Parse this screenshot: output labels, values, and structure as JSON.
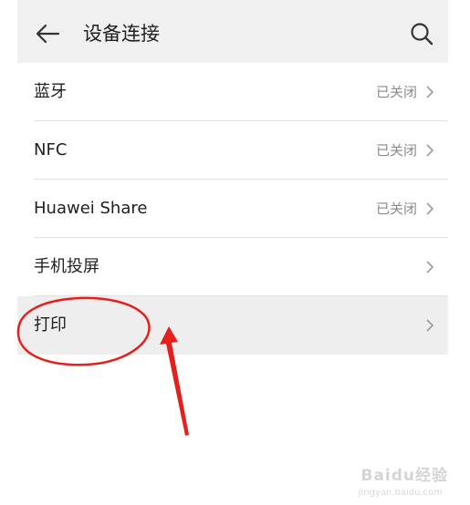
{
  "header": {
    "back_icon": "arrow-left-icon",
    "title": "设备连接",
    "search_icon": "search-icon"
  },
  "settings": [
    {
      "label": "蓝牙",
      "status": "已关闭",
      "icon": "chevron-right-icon"
    },
    {
      "label": "NFC",
      "status": "已关闭",
      "icon": "chevron-right-icon"
    },
    {
      "label": "Huawei Share",
      "status": "已关闭",
      "icon": "chevron-right-icon"
    },
    {
      "label": "手机投屏",
      "status": "",
      "icon": "chevron-right-icon"
    },
    {
      "label": "打印",
      "status": "",
      "icon": "chevron-right-icon",
      "highlighted": true
    }
  ],
  "annotation": {
    "color": "#e3201b",
    "target": "打印"
  },
  "watermark": {
    "text": "Baidu经验",
    "sub": "jingyan.baidu.com"
  },
  "colors": {
    "header_bg": "#f0f0f0",
    "highlight_bg": "#eeeeee",
    "status_text": "#8a8a8a"
  }
}
